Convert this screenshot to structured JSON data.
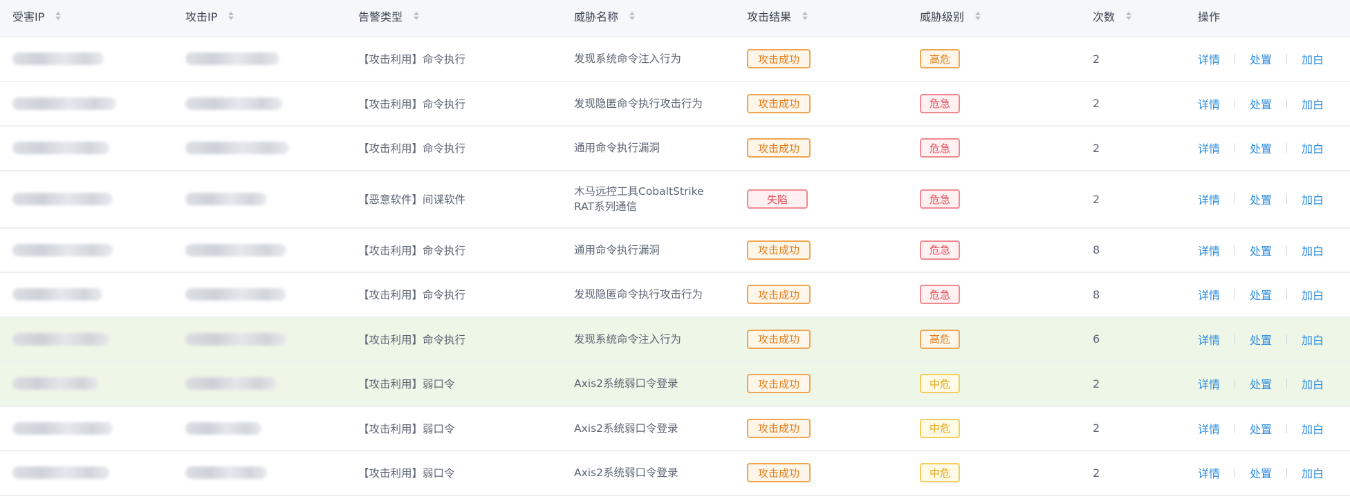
{
  "columns": {
    "victim_ip": "受害IP",
    "attack_ip": "攻击IP",
    "alert_type": "告警类型",
    "threat_name": "威胁名称",
    "attack_result": "攻击结果",
    "threat_level": "威胁级别",
    "count": "次数",
    "actions": "操作"
  },
  "action_labels": {
    "detail": "详情",
    "handle": "处置",
    "whitelist": "加白"
  },
  "colors": {
    "link": "#2a8bdd",
    "highlight_row": "#eef6e7",
    "orange": "#e17f1d",
    "red": "#e3505b",
    "yellow": "#e1a514"
  },
  "rows": [
    {
      "alert_type": "【攻击利用】命令执行",
      "threat_name": "发现系统命令注入行为",
      "attack_result": "攻击成功",
      "result_style": "orange",
      "threat_level": "高危",
      "level_style": "orange",
      "count": "2"
    },
    {
      "alert_type": "【攻击利用】命令执行",
      "threat_name": "发现隐匿命令执行攻击行为",
      "attack_result": "攻击成功",
      "result_style": "orange",
      "threat_level": "危急",
      "level_style": "red",
      "count": "2"
    },
    {
      "alert_type": "【攻击利用】命令执行",
      "threat_name": "通用命令执行漏洞",
      "attack_result": "攻击成功",
      "result_style": "orange",
      "threat_level": "危急",
      "level_style": "red",
      "count": "2"
    },
    {
      "alert_type": "【恶意软件】间谍软件",
      "threat_name": "木马远控工具CobaltStrike RAT系列通信",
      "attack_result": "失陷",
      "result_style": "red",
      "threat_level": "危急",
      "level_style": "red",
      "count": "2"
    },
    {
      "alert_type": "【攻击利用】命令执行",
      "threat_name": "通用命令执行漏洞",
      "attack_result": "攻击成功",
      "result_style": "orange",
      "threat_level": "危急",
      "level_style": "red",
      "count": "8"
    },
    {
      "alert_type": "【攻击利用】命令执行",
      "threat_name": "发现隐匿命令执行攻击行为",
      "attack_result": "攻击成功",
      "result_style": "orange",
      "threat_level": "危急",
      "level_style": "red",
      "count": "8"
    },
    {
      "alert_type": "【攻击利用】命令执行",
      "threat_name": "发现系统命令注入行为",
      "attack_result": "攻击成功",
      "result_style": "orange",
      "threat_level": "高危",
      "level_style": "orange",
      "count": "6"
    },
    {
      "alert_type": "【攻击利用】弱口令",
      "threat_name": "Axis2系统弱口令登录",
      "attack_result": "攻击成功",
      "result_style": "orange",
      "threat_level": "中危",
      "level_style": "yellow",
      "count": "2"
    },
    {
      "alert_type": "【攻击利用】弱口令",
      "threat_name": "Axis2系统弱口令登录",
      "attack_result": "攻击成功",
      "result_style": "orange",
      "threat_level": "中危",
      "level_style": "yellow",
      "count": "2"
    },
    {
      "alert_type": "【攻击利用】弱口令",
      "threat_name": "Axis2系统弱口令登录",
      "attack_result": "攻击成功",
      "result_style": "orange",
      "threat_level": "中危",
      "level_style": "yellow",
      "count": "2"
    }
  ]
}
